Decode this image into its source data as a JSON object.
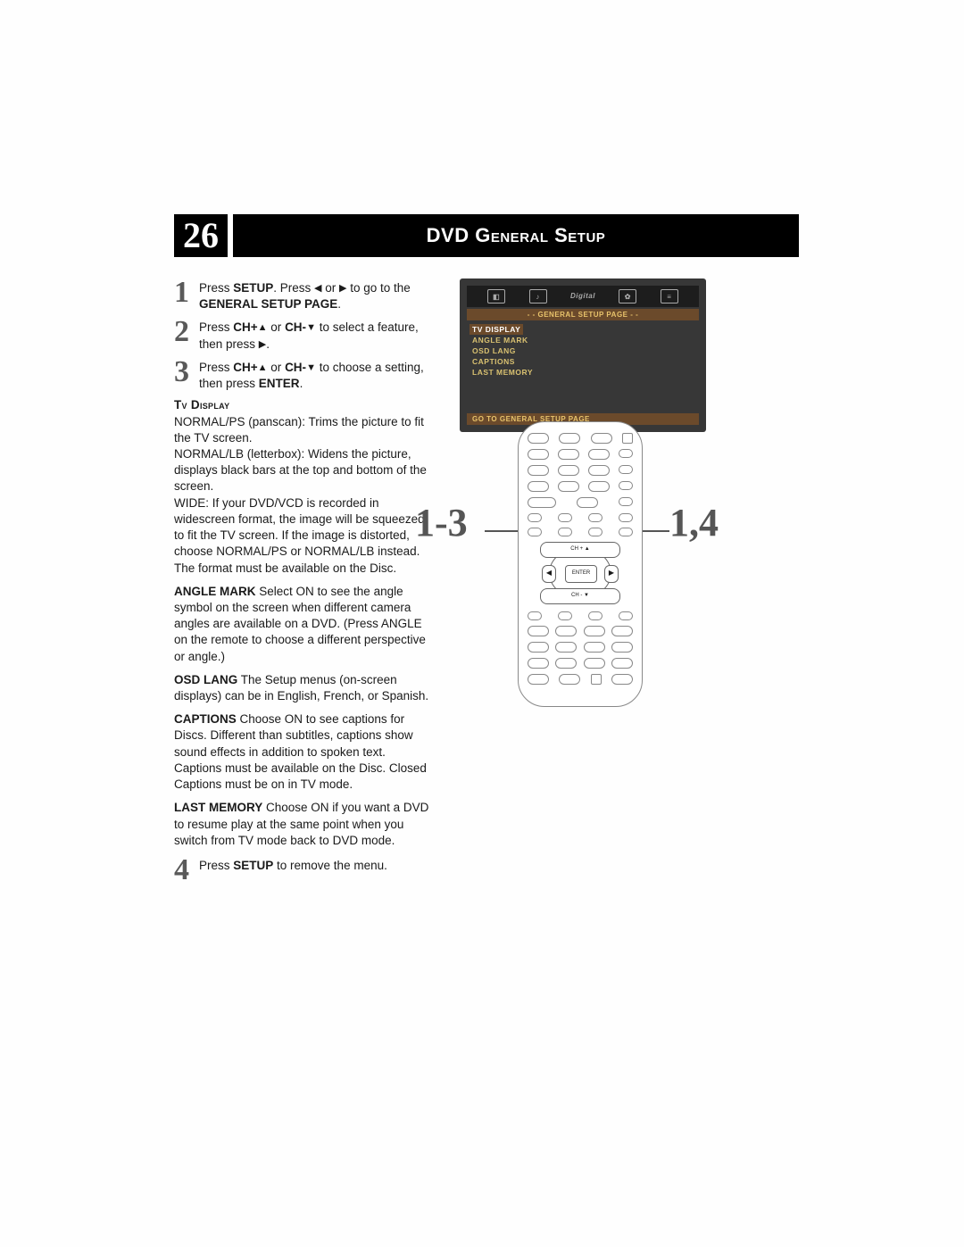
{
  "page_number": "26",
  "title": "DVD General Setup",
  "steps": [
    {
      "num": "1",
      "text_a": "Press ",
      "b1": "SETUP",
      "text_b": ". Press ",
      "sym1": "◀",
      "text_c": " or ",
      "sym2": "▶",
      "text_d": " to go to the ",
      "b2": "GENERAL SETUP PAGE",
      "text_e": "."
    },
    {
      "num": "2",
      "text_a": "Press ",
      "b1": "CH+",
      "sym1": "▲",
      "text_b": " or ",
      "b2": "CH-",
      "sym2": "▼",
      "text_c": " to select a feature, then press ",
      "sym3": "▶",
      "text_d": "."
    },
    {
      "num": "3",
      "text_a": "Press ",
      "b1": "CH+",
      "sym1": "▲",
      "text_b": " or ",
      "b2": "CH-",
      "sym2": "▼",
      "text_c": " to choose a setting, then press ",
      "b3": "ENTER",
      "text_d": "."
    }
  ],
  "tv_display_head": "Tv Display",
  "tv_display_body": [
    "NORMAL/PS (panscan): Trims the picture to fit the TV screen.",
    "NORMAL/LB (letterbox): Widens the picture, displays black bars at the top and bottom of the screen.",
    "WIDE: If your DVD/VCD is recorded in widescreen format, the image will be squeezed to fit the TV screen. If the image is distorted, choose NORMAL/PS or NORMAL/LB instead.",
    "The format must be available on the Disc."
  ],
  "features": [
    {
      "label": "ANGLE MARK",
      "text": " Select ON to see the angle symbol on the screen when different camera angles are available on a DVD. (Press ANGLE on the remote to choose a different perspective or angle.)"
    },
    {
      "label": "OSD LANG",
      "text": " The Setup menus (on-screen displays) can be in English, French, or Spanish."
    },
    {
      "label": "CAPTIONS",
      "text": " Choose ON to see captions for Discs. Different than subtitles, captions show sound effects in addition to spoken text. Captions must be available on the Disc. Closed Captions must be on in TV mode."
    },
    {
      "label": "LAST MEMORY",
      "text": " Choose ON if you want a DVD to resume play at the same point when you switch from TV mode back to DVD mode."
    }
  ],
  "step4": {
    "num": "4",
    "text_a": "Press ",
    "b1": "SETUP",
    "text_b": " to remove the menu."
  },
  "osd": {
    "banner": "- -  GENERAL  SETUP  PAGE  - -",
    "items": [
      "TV DISPLAY",
      "ANGLE MARK",
      "OSD LANG",
      "CAPTIONS",
      "LAST MEMORY"
    ],
    "footer": "GO TO GENERAL SETUP PAGE",
    "icon_digital": "Digital"
  },
  "dpad": {
    "up": "CH + ▲",
    "down": "CH - ▼",
    "enter": "ENTER",
    "left": "◀",
    "right": "▶"
  },
  "callouts": {
    "left": "1-3",
    "right": "1,4"
  }
}
